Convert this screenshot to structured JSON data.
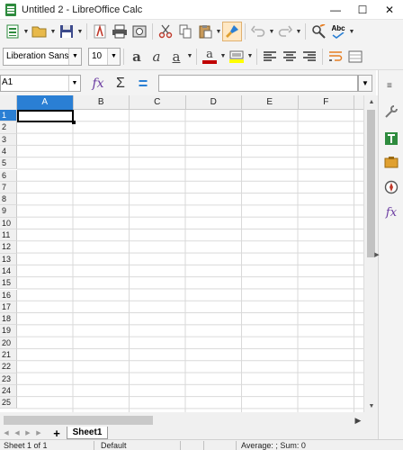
{
  "window": {
    "title": "Untitled 2 - LibreOffice Calc",
    "minimize": "—",
    "maximize": "☐",
    "close": "✕"
  },
  "toolbar_standard": {
    "buttons": [
      "new-spreadsheet",
      "open",
      "save",
      "export-pdf",
      "print",
      "print-preview",
      "cut",
      "copy",
      "paste",
      "clone-formatting",
      "undo",
      "redo",
      "find-replace",
      "spelling"
    ],
    "spelling_label": "Abc"
  },
  "toolbar_formatting": {
    "font_name": "Liberation Sans",
    "font_size": "10",
    "bold_label": "a",
    "italic_label": "a",
    "underline_label": "a",
    "font_color": "#c00000",
    "highlight_color": "#ffff00",
    "font_color_label": "a"
  },
  "formula_bar": {
    "name_box": "A1",
    "sum_symbol": "Σ",
    "equals_symbol": "=",
    "content": ""
  },
  "grid": {
    "columns": [
      "A",
      "B",
      "C",
      "D",
      "E",
      "F"
    ],
    "active_column": "A",
    "rows": [
      "1",
      "2",
      "3",
      "4",
      "5",
      "6",
      "7",
      "8",
      "9",
      "10",
      "11",
      "12",
      "13",
      "14",
      "15",
      "16",
      "17",
      "18",
      "19",
      "20",
      "21",
      "22",
      "23",
      "24",
      "25"
    ],
    "active_row": "1",
    "active_cell": "A1"
  },
  "sheets": {
    "tabs": [
      "Sheet1"
    ],
    "active": "Sheet1",
    "add_label": "+"
  },
  "status_bar": {
    "sheet_position": "Sheet 1 of 1",
    "page_style": "Default",
    "summary": "Average: ; Sum: 0"
  },
  "colors": {
    "accent": "#2a7fd4",
    "toolbar_bg": "#f3f3f3"
  }
}
